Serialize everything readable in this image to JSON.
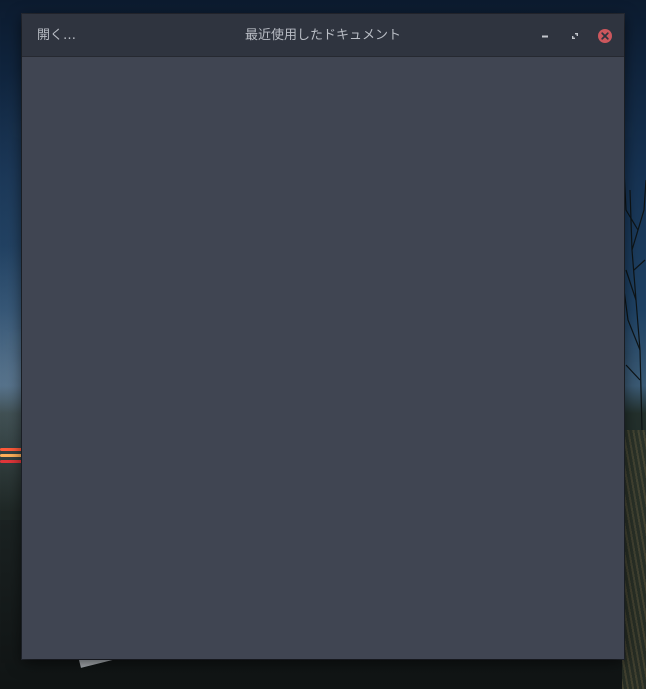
{
  "window": {
    "title": "最近使用したドキュメント",
    "open_label": "開く…",
    "buttons": {
      "minimize_icon": "minimize-icon",
      "maximize_icon": "maximize-icon",
      "close_icon": "close-icon"
    }
  },
  "colors": {
    "titlebar": "#2f343f",
    "window_body": "#404552",
    "title_text": "#b9bdc5",
    "close_button": "#cc575d"
  }
}
